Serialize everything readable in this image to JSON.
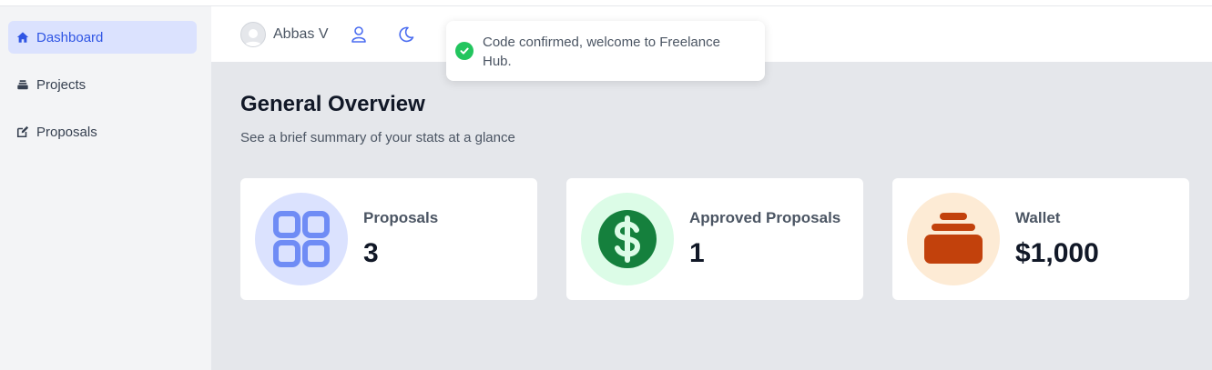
{
  "sidebar": {
    "items": [
      {
        "label": "Dashboard",
        "icon": "home-icon",
        "active": true
      },
      {
        "label": "Projects",
        "icon": "inbox-stack-icon"
      },
      {
        "label": "Proposals",
        "icon": "edit-icon"
      }
    ]
  },
  "header": {
    "username": "Abbas V",
    "icons": [
      "user-icon",
      "moon-icon"
    ]
  },
  "toast": {
    "message": "Code confirmed, welcome to Freelance Hub.",
    "icon": "check-circle-icon"
  },
  "main": {
    "title": "General Overview",
    "subtitle": "See a brief summary of your stats at a glance"
  },
  "cards": [
    {
      "label": "Proposals",
      "value": "3",
      "icon": "grid-icon",
      "bg": "#dbe2fe",
      "fg": "#6f8cf5"
    },
    {
      "label": "Approved Proposals",
      "value": "1",
      "icon": "dollar-icon",
      "bg": "#dcfce7",
      "fg": "#15803d"
    },
    {
      "label": "Wallet",
      "value": "$1,000",
      "icon": "wallet-stack-icon",
      "bg": "#fdebd5",
      "fg": "#c2410c"
    }
  ],
  "colors": {
    "accent": "#2f55e4",
    "sidebar_bg": "#f3f4f6",
    "main_bg": "#e5e7eb",
    "success": "#22c55e"
  }
}
